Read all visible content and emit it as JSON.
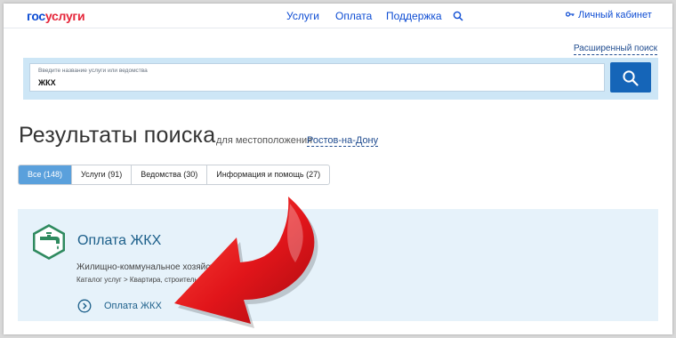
{
  "header": {
    "logo_part1": "гос",
    "logo_part2": "услуги",
    "nav": [
      "Услуги",
      "Оплата",
      "Поддержка"
    ],
    "search_icon": "search-icon",
    "cabinet_label": "Личный кабинет",
    "cabinet_icon": "key-icon"
  },
  "search": {
    "advanced_link": "Расширенный поиск",
    "placeholder": "Введите название услуги или ведомства",
    "value": "ЖКХ",
    "button_icon": "search-icon"
  },
  "results": {
    "title": "Результаты поиска",
    "for_location": "для местоположения",
    "city": "Ростов-на-Дону",
    "tabs": [
      {
        "label": "Все (148)",
        "active": true
      },
      {
        "label": "Услуги (91)",
        "active": false
      },
      {
        "label": "Ведомства (30)",
        "active": false
      },
      {
        "label": "Информация и помощь (27)",
        "active": false
      }
    ]
  },
  "card": {
    "icon": "water-tap-icon",
    "title": "Оплата ЖКХ",
    "description": "Жилищно-коммунальное хозяйство",
    "path": "Каталог услуг > Квартира, строительство и земля",
    "link_label": "Оплата ЖКХ",
    "link_icon": "chevron-right-circle-icon"
  },
  "colors": {
    "brand_blue": "#0d4cd3",
    "brand_red": "#e5263a",
    "search_button": "#1565b8",
    "active_tab": "#5aa0dc",
    "card_bg": "#e6f2fa",
    "icon_green": "#2f8a5f",
    "arrow_red": "#e1151a"
  }
}
